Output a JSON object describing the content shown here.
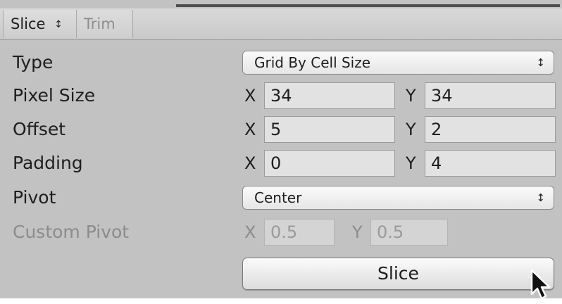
{
  "toolbar": {
    "slice_label": "Slice",
    "slice_arrows": "↕",
    "trim_label": "Trim"
  },
  "rows": {
    "type": {
      "label": "Type",
      "value": "Grid By Cell Size",
      "arrows": "↕"
    },
    "pixel_size": {
      "label": "Pixel Size",
      "x_axis": "X",
      "x_value": "34",
      "y_axis": "Y",
      "y_value": "34"
    },
    "offset": {
      "label": "Offset",
      "x_axis": "X",
      "x_value": "5",
      "y_axis": "Y",
      "y_value": "2"
    },
    "padding": {
      "label": "Padding",
      "x_axis": "X",
      "x_value": "0",
      "y_axis": "Y",
      "y_value": "4"
    },
    "pivot": {
      "label": "Pivot",
      "value": "Center",
      "arrows": "↕"
    },
    "custom_pivot": {
      "label": "Custom Pivot",
      "x_axis": "X",
      "x_value": "0.5",
      "y_axis": "Y",
      "y_value": "0.5"
    }
  },
  "slice_button": {
    "label": "Slice"
  },
  "colors": {
    "panel": "#c2c2c2",
    "field": "#e2e2e2",
    "disabled_text": "#8c8c8c"
  },
  "icons": {
    "cursor": "arrow-cursor-icon",
    "dropdown": "updown-arrows-icon"
  }
}
